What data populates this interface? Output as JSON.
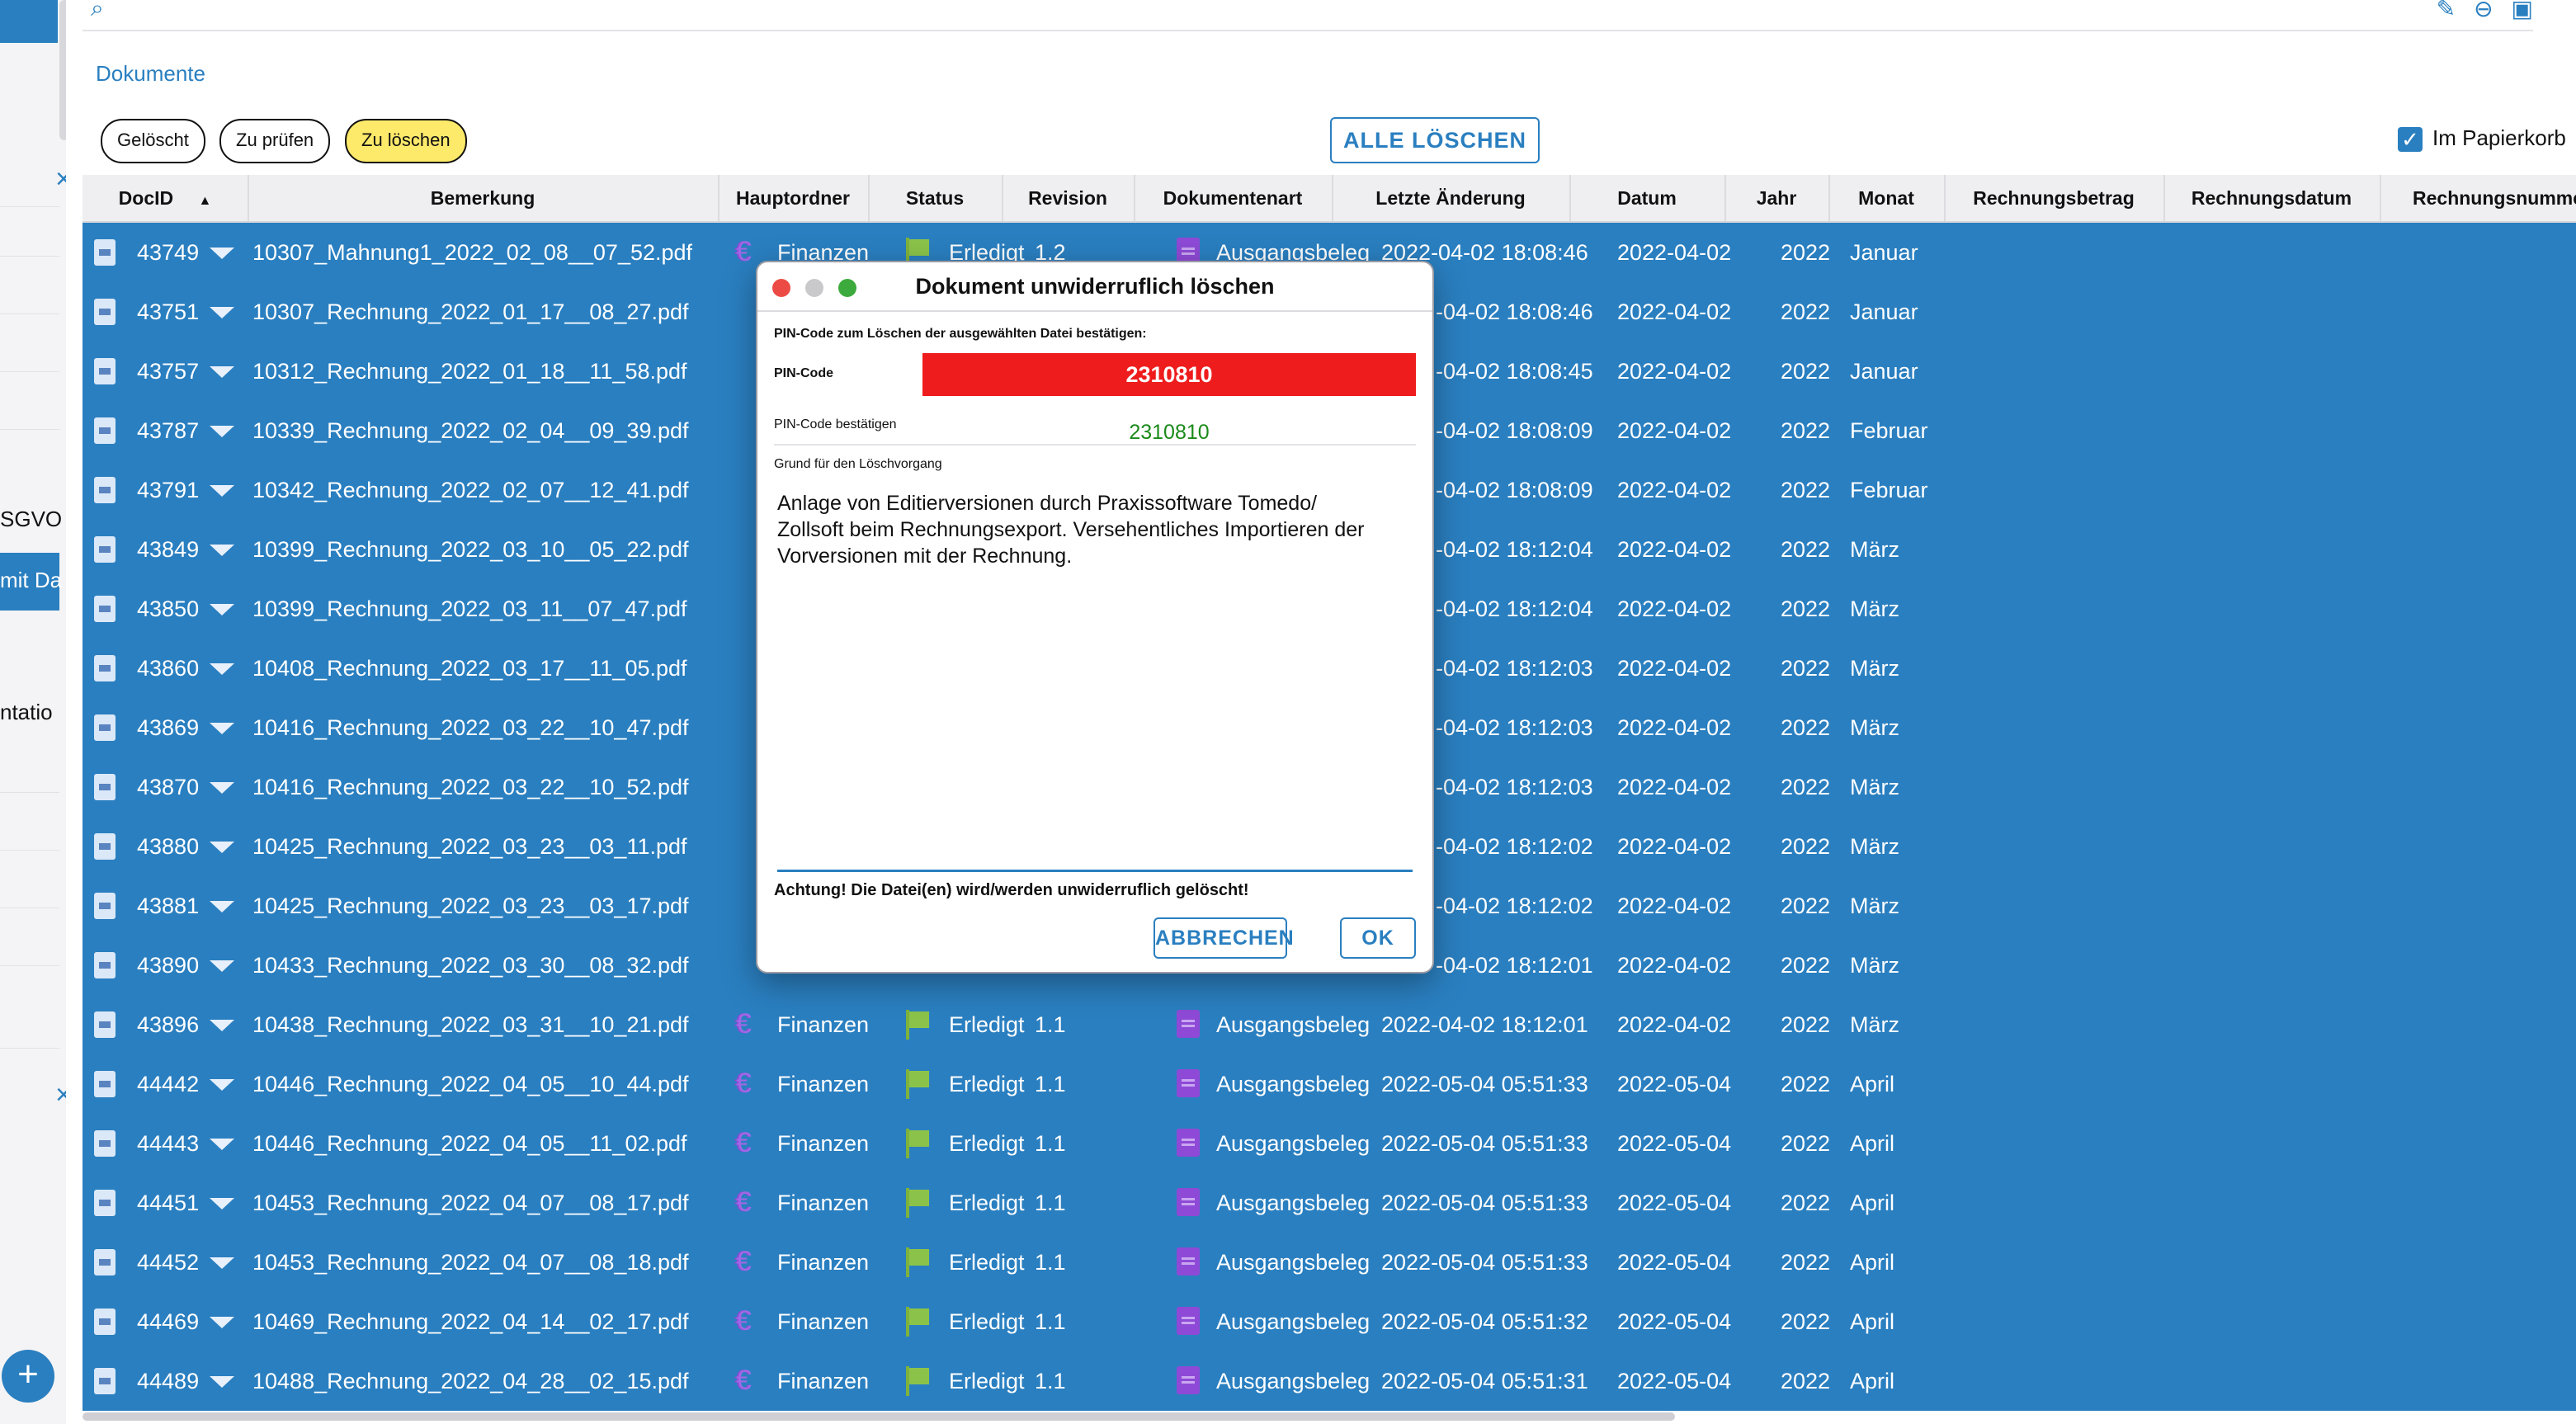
{
  "sidebar": {
    "text_1": "SGVO",
    "text_selected": "mit Da",
    "text_2": "ntatio"
  },
  "breadcrumb": "Dokumente",
  "filters": [
    {
      "label": "Gelöscht",
      "active": false
    },
    {
      "label": "Zu prüfen",
      "active": false
    },
    {
      "label": "Zu löschen",
      "active": true
    }
  ],
  "delete_all_label": "ALLE LÖSCHEN",
  "trash_label": "Im Papierkorb",
  "columns": [
    "DocID",
    "Bemerkung",
    "Hauptordner",
    "Status",
    "Revision",
    "Dokumentenart",
    "Letzte Änderung",
    "Datum",
    "Jahr",
    "Monat",
    "Rechnungsbetrag",
    "Rechnungsdatum",
    "Rechnungsnumme"
  ],
  "rows": [
    {
      "id": "43749",
      "name": "10307_Mahnung1_2022_02_08__07_52.pdf",
      "folder": "Finanzen",
      "status": "Erledigt",
      "rev": "1.2",
      "type": "Ausgangsbeleg",
      "changed": "2022-04-02 18:08:46",
      "date": "2022-04-02",
      "year": "2022",
      "month": "Januar"
    },
    {
      "id": "43751",
      "name": "10307_Rechnung_2022_01_17__08_27.pdf",
      "folder": "",
      "status": "",
      "rev": "",
      "type": "",
      "changed": "-04-02 18:08:46",
      "date": "2022-04-02",
      "year": "2022",
      "month": "Januar"
    },
    {
      "id": "43757",
      "name": "10312_Rechnung_2022_01_18__11_58.pdf",
      "folder": "",
      "status": "",
      "rev": "",
      "type": "",
      "changed": "-04-02 18:08:45",
      "date": "2022-04-02",
      "year": "2022",
      "month": "Januar"
    },
    {
      "id": "43787",
      "name": "10339_Rechnung_2022_02_04__09_39.pdf",
      "folder": "",
      "status": "",
      "rev": "",
      "type": "",
      "changed": "-04-02 18:08:09",
      "date": "2022-04-02",
      "year": "2022",
      "month": "Februar"
    },
    {
      "id": "43791",
      "name": "10342_Rechnung_2022_02_07__12_41.pdf",
      "folder": "",
      "status": "",
      "rev": "",
      "type": "",
      "changed": "-04-02 18:08:09",
      "date": "2022-04-02",
      "year": "2022",
      "month": "Februar"
    },
    {
      "id": "43849",
      "name": "10399_Rechnung_2022_03_10__05_22.pdf",
      "folder": "",
      "status": "",
      "rev": "",
      "type": "",
      "changed": "-04-02 18:12:04",
      "date": "2022-04-02",
      "year": "2022",
      "month": "März"
    },
    {
      "id": "43850",
      "name": "10399_Rechnung_2022_03_11__07_47.pdf",
      "folder": "",
      "status": "",
      "rev": "",
      "type": "",
      "changed": "-04-02 18:12:04",
      "date": "2022-04-02",
      "year": "2022",
      "month": "März"
    },
    {
      "id": "43860",
      "name": "10408_Rechnung_2022_03_17__11_05.pdf",
      "folder": "",
      "status": "",
      "rev": "",
      "type": "",
      "changed": "-04-02 18:12:03",
      "date": "2022-04-02",
      "year": "2022",
      "month": "März"
    },
    {
      "id": "43869",
      "name": "10416_Rechnung_2022_03_22__10_47.pdf",
      "folder": "",
      "status": "",
      "rev": "",
      "type": "",
      "changed": "-04-02 18:12:03",
      "date": "2022-04-02",
      "year": "2022",
      "month": "März"
    },
    {
      "id": "43870",
      "name": "10416_Rechnung_2022_03_22__10_52.pdf",
      "folder": "",
      "status": "",
      "rev": "",
      "type": "",
      "changed": "-04-02 18:12:03",
      "date": "2022-04-02",
      "year": "2022",
      "month": "März"
    },
    {
      "id": "43880",
      "name": "10425_Rechnung_2022_03_23__03_11.pdf",
      "folder": "",
      "status": "",
      "rev": "",
      "type": "",
      "changed": "-04-02 18:12:02",
      "date": "2022-04-02",
      "year": "2022",
      "month": "März"
    },
    {
      "id": "43881",
      "name": "10425_Rechnung_2022_03_23__03_17.pdf",
      "folder": "",
      "status": "",
      "rev": "",
      "type": "",
      "changed": "-04-02 18:12:02",
      "date": "2022-04-02",
      "year": "2022",
      "month": "März"
    },
    {
      "id": "43890",
      "name": "10433_Rechnung_2022_03_30__08_32.pdf",
      "folder": "",
      "status": "",
      "rev": "",
      "type": "",
      "changed": "-04-02 18:12:01",
      "date": "2022-04-02",
      "year": "2022",
      "month": "März"
    },
    {
      "id": "43896",
      "name": "10438_Rechnung_2022_03_31__10_21.pdf",
      "folder": "Finanzen",
      "status": "Erledigt",
      "rev": "1.1",
      "type": "Ausgangsbeleg",
      "changed": "2022-04-02 18:12:01",
      "date": "2022-04-02",
      "year": "2022",
      "month": "März"
    },
    {
      "id": "44442",
      "name": "10446_Rechnung_2022_04_05__10_44.pdf",
      "folder": "Finanzen",
      "status": "Erledigt",
      "rev": "1.1",
      "type": "Ausgangsbeleg",
      "changed": "2022-05-04 05:51:33",
      "date": "2022-05-04",
      "year": "2022",
      "month": "April"
    },
    {
      "id": "44443",
      "name": "10446_Rechnung_2022_04_05__11_02.pdf",
      "folder": "Finanzen",
      "status": "Erledigt",
      "rev": "1.1",
      "type": "Ausgangsbeleg",
      "changed": "2022-05-04 05:51:33",
      "date": "2022-05-04",
      "year": "2022",
      "month": "April"
    },
    {
      "id": "44451",
      "name": "10453_Rechnung_2022_04_07__08_17.pdf",
      "folder": "Finanzen",
      "status": "Erledigt",
      "rev": "1.1",
      "type": "Ausgangsbeleg",
      "changed": "2022-05-04 05:51:33",
      "date": "2022-05-04",
      "year": "2022",
      "month": "April"
    },
    {
      "id": "44452",
      "name": "10453_Rechnung_2022_04_07__08_18.pdf",
      "folder": "Finanzen",
      "status": "Erledigt",
      "rev": "1.1",
      "type": "Ausgangsbeleg",
      "changed": "2022-05-04 05:51:33",
      "date": "2022-05-04",
      "year": "2022",
      "month": "April"
    },
    {
      "id": "44469",
      "name": "10469_Rechnung_2022_04_14__02_17.pdf",
      "folder": "Finanzen",
      "status": "Erledigt",
      "rev": "1.1",
      "type": "Ausgangsbeleg",
      "changed": "2022-05-04 05:51:32",
      "date": "2022-05-04",
      "year": "2022",
      "month": "April"
    },
    {
      "id": "44489",
      "name": "10488_Rechnung_2022_04_28__02_15.pdf",
      "folder": "Finanzen",
      "status": "Erledigt",
      "rev": "1.1",
      "type": "Ausgangsbeleg",
      "changed": "2022-05-04 05:51:31",
      "date": "2022-05-04",
      "year": "2022",
      "month": "April"
    }
  ],
  "dialog": {
    "title": "Dokument unwiderruflich löschen",
    "instruction": "PIN-Code zum Löschen der ausgewählten Datei bestätigen:",
    "pin_label": "PIN-Code",
    "pin_value": "2310810",
    "pin_confirm_label": "PIN-Code bestätigen",
    "pin_confirm_value": "2310810",
    "reason_label": "Grund für den Löschvorgang",
    "reason_text": "Anlage von Editierversionen durch Praxissoftware Tomedo/\nZollsoft beim Rechnungsexport. Versehentliches Importieren der\nVorversionen mit der Rechnung.",
    "warning": "Achtung! Die Datei(en) wird/werden unwiderruflich gelöscht!",
    "cancel_label": "ABBRECHEN",
    "ok_label": "OK"
  },
  "colors": {
    "accent": "#2a7fc0",
    "pin_bg": "#ee1c1c",
    "active_filter": "#fde96a",
    "confirm_text": "#1a8a1a"
  }
}
